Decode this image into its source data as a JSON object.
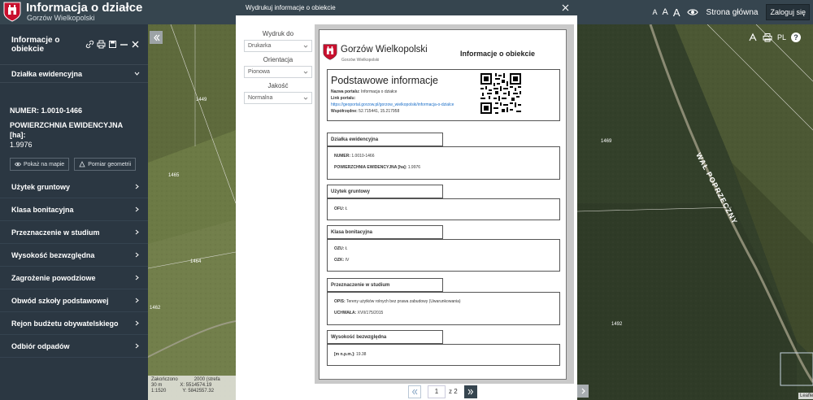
{
  "header": {
    "title": "Informacja o działce",
    "subtitle": "Gorzów Wielkopolski",
    "font_small": "A",
    "font_medium": "A",
    "font_large": "A",
    "home_link": "Strona główna",
    "login_button": "Zaloguj się"
  },
  "sidebar": {
    "panel_title": "Informacje o obiekcie",
    "section_title": "Działka ewidencyjna",
    "number_label": "NUMER:",
    "number_value": "1.0010-1466",
    "area_label": "POWIERZCHNIA EWIDENCYJNA [ha]:",
    "area_value": "1.9976",
    "show_on_map": "Pokaż na mapie",
    "measure_geometry": "Pomiar geometrii",
    "menu": [
      {
        "label": "Użytek gruntowy"
      },
      {
        "label": "Klasa bonitacyjna"
      },
      {
        "label": "Przeznaczenie w studium"
      },
      {
        "label": "Wysokość bezwzględna"
      },
      {
        "label": "Zagrożenie powodziowe"
      },
      {
        "label": "Obwód szkoły podstawowej"
      },
      {
        "label": "Rejon budżetu obywatelskiego"
      },
      {
        "label": "Odbiór odpadów"
      }
    ]
  },
  "map": {
    "parcel_labels": [
      "1449",
      "1465",
      "1464",
      "1462",
      "1469",
      "1492"
    ],
    "street_label": "WAŁ POPRZECZNY",
    "lang_button": "PL",
    "help_button": "?",
    "scale_text": "Zakończono",
    "scale_value": "2000 (strefa",
    "scale_unit": "30 m",
    "scale_ratio": "1:1520",
    "coord_x": "X: 5514574.19",
    "coord_y": "Y: 5842557.32",
    "attribution": "Leaflet"
  },
  "modal": {
    "title": "Wydrukuj informacje o obiekcie",
    "print_to_label": "Wydruk do",
    "print_to_value": "Drukarka",
    "orientation_label": "Orientacja",
    "orientation_value": "Pionowa",
    "quality_label": "Jakość",
    "quality_value": "Normalna",
    "page_current": "1",
    "page_of": "z 2"
  },
  "document": {
    "city": "Gorzów Wielkopolski",
    "city_sub": "Gorzów Wielkopolski",
    "title": "Informacje o obiekcie",
    "basic_title": "Podstawowe informacje",
    "portal_name_label": "Nazwa portalu:",
    "portal_name_value": "Informacja o działce",
    "portal_link_label": "Link portalu:",
    "portal_link_value": "https://geoportal.gorzow.pl/gorzow_wielkopolski/informacja-o-dzialce",
    "coords_label": "Współrzędne:",
    "coords_value": "52.715441, 15.217958",
    "sections": [
      {
        "title": "Działka ewidencyjna",
        "rows": [
          {
            "label": "NUMER:",
            "value": "1.0010-1466"
          },
          {
            "label": "POWIERZCHNIA EWIDENCYJNA [ha]:",
            "value": "1.9976"
          }
        ]
      },
      {
        "title": "Użytek gruntowy",
        "rows": [
          {
            "label": "OFU:",
            "value": "Ł"
          }
        ]
      },
      {
        "title": "Klasa bonitacyjna",
        "rows": [
          {
            "label": "OZU:",
            "value": "Ł"
          },
          {
            "label": "OZK:",
            "value": "IV"
          }
        ]
      },
      {
        "title": "Przeznaczenie w studium",
        "rows": [
          {
            "label": "OPIS:",
            "value": "Tereny użytków rolnych bez prawa zabudowy (Uwarunkowania)"
          },
          {
            "label": "UCHWAŁA:",
            "value": "XVII/175/2015"
          }
        ]
      },
      {
        "title": "Wysokość bezwzględna",
        "rows": [
          {
            "label": "[m n.p.m.]:",
            "value": "19.38"
          }
        ]
      }
    ]
  },
  "colors": {
    "header": "#36454f",
    "sidebar": "#2b3742",
    "link": "#1a6ec8",
    "pager_active": "#36454f"
  }
}
